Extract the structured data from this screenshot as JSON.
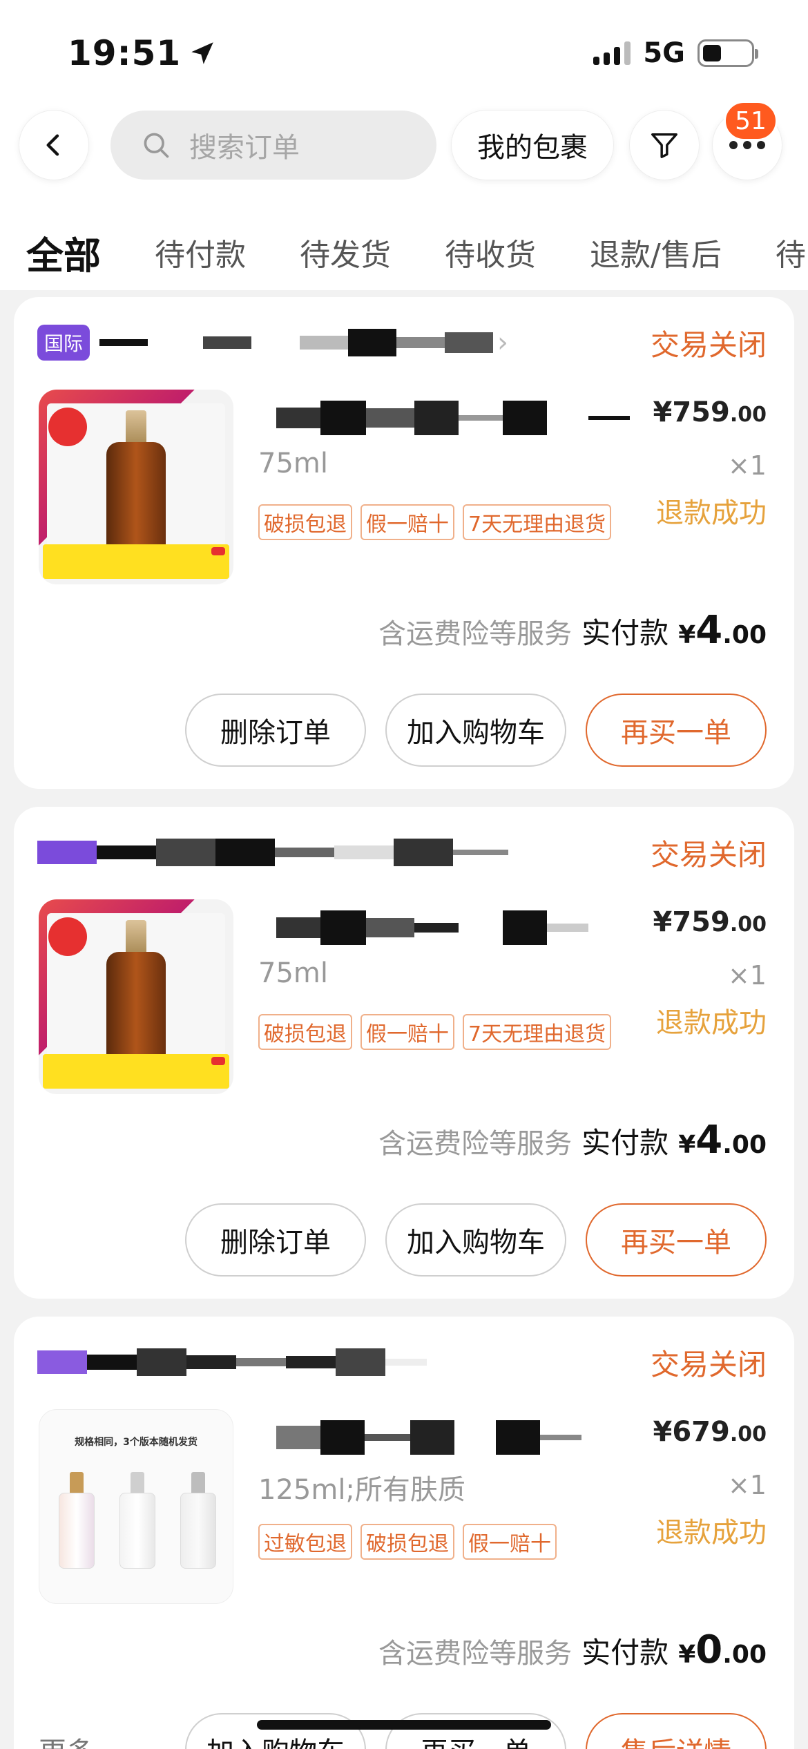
{
  "status_bar": {
    "time": "19:51",
    "network": "5G"
  },
  "header": {
    "search_placeholder": "搜索订单",
    "my_packages": "我的包裹",
    "more_badge": "51"
  },
  "tabs": [
    "全部",
    "待付款",
    "待发货",
    "待收货",
    "退款/售后",
    "待"
  ],
  "orders": [
    {
      "store_tag": "国际",
      "status": "交易关闭",
      "price_main": "¥759",
      "price_dec": ".00",
      "spec": "75ml",
      "qty": "×1",
      "tags": [
        "破损包退",
        "假一赔十",
        "7天无理由退货"
      ],
      "refund": "退款成功",
      "service": "含运费险等服务",
      "paid_label": "实付款",
      "paid_currency": "¥",
      "paid_int": "4",
      "paid_dec": ".00",
      "buttons": [
        "删除订单",
        "加入购物车",
        "再买一单"
      ]
    },
    {
      "status": "交易关闭",
      "price_main": "¥759",
      "price_dec": ".00",
      "spec": "75ml",
      "qty": "×1",
      "tags": [
        "破损包退",
        "假一赔十",
        "7天无理由退货"
      ],
      "refund": "退款成功",
      "service": "含运费险等服务",
      "paid_label": "实付款",
      "paid_currency": "¥",
      "paid_int": "4",
      "paid_dec": ".00",
      "buttons": [
        "删除订单",
        "加入购物车",
        "再买一单"
      ]
    },
    {
      "status": "交易关闭",
      "price_main": "¥679",
      "price_dec": ".00",
      "spec": "125ml;所有肤质",
      "qty": "×1",
      "tags": [
        "过敏包退",
        "破损包退",
        "假一赔十"
      ],
      "refund": "退款成功",
      "service": "含运费险等服务",
      "paid_label": "实付款",
      "paid_currency": "¥",
      "paid_int": "0",
      "paid_dec": ".00",
      "thumb_caption": "规格相同，3个版本随机发货",
      "buttons": [
        "加入购物车",
        "再买一单",
        "售后详情"
      ]
    }
  ],
  "footer": {
    "more": "更多"
  },
  "colors": {
    "accent": "#e0682d",
    "refund": "#e6a23c",
    "badge": "#ff5a1f",
    "tmall": "#7b4bdb"
  }
}
